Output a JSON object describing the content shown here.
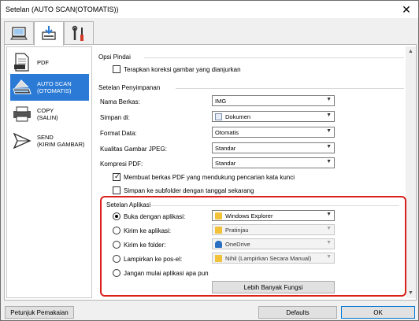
{
  "window": {
    "title": "Setelan (AUTO SCAN(OTOMATIS))",
    "close_glyph": "✕"
  },
  "tabs": [
    {
      "name": "computer-tab",
      "icon": "computer-icon"
    },
    {
      "name": "scan-to-pc-tab",
      "icon": "scan-to-pc-icon"
    },
    {
      "name": "general-settings-tab",
      "icon": "tools-icon"
    }
  ],
  "sidebar": {
    "items": [
      {
        "label": "PDF",
        "icon": "pdf-document-icon",
        "selected": false
      },
      {
        "label": "AUTO SCAN\n(OTOMATIS)",
        "icon": "auto-scan-icon",
        "selected": true
      },
      {
        "label": "COPY\n(SALIN)",
        "icon": "printer-icon",
        "selected": false
      },
      {
        "label": "SEND\n(KIRIM GAMBAR)",
        "icon": "send-arrow-icon",
        "selected": false
      }
    ]
  },
  "scan_options": {
    "title": "Opsi Pindai",
    "auto_correct_label": "Terapkan koreksi gambar yang dianjurkan"
  },
  "save_settings": {
    "title": "Setelan Penyimpanan",
    "file_name_label": "Nama Berkas:",
    "file_name_value": "IMG",
    "save_in_label": "Simpan di:",
    "save_in_value": "Dokumen",
    "data_format_label": "Format Data:",
    "data_format_value": "Otomatis",
    "jpeg_quality_label": "Kualitas Gambar JPEG:",
    "jpeg_quality_value": "Standar",
    "pdf_compression_label": "Kompresi PDF:",
    "pdf_compression_value": "Standar",
    "keyword_pdf_label": "Membuat berkas PDF yang mendukung pencarian kata kunci",
    "subfolder_label": "Simpan ke subfolder dengan tanggal sekarang"
  },
  "app_settings": {
    "title": "Setelan Aplikasi",
    "open_with_label": "Buka dengan aplikasi:",
    "open_with_value": "Windows Explorer",
    "send_to_app_label": "Kirim ke aplikasi:",
    "send_to_app_value": "Pratinjau",
    "send_to_folder_label": "Kirim ke folder:",
    "send_to_folder_value": "OneDrive",
    "attach_email_label": "Lampirkan ke pos-el:",
    "attach_email_value": "Nihil (Lampirkan Secara Manual)",
    "do_not_start_label": "Jangan mulai aplikasi apa pun",
    "more_functions_label": "Lebih Banyak Fungsi"
  },
  "footer": {
    "instructions_label": "Petunjuk Pemakaian",
    "defaults_label": "Defaults",
    "ok_label": "OK"
  },
  "colors": {
    "selection": "#2b7bd6",
    "highlight_box": "#d9201a",
    "folder": "#f2c33a"
  }
}
